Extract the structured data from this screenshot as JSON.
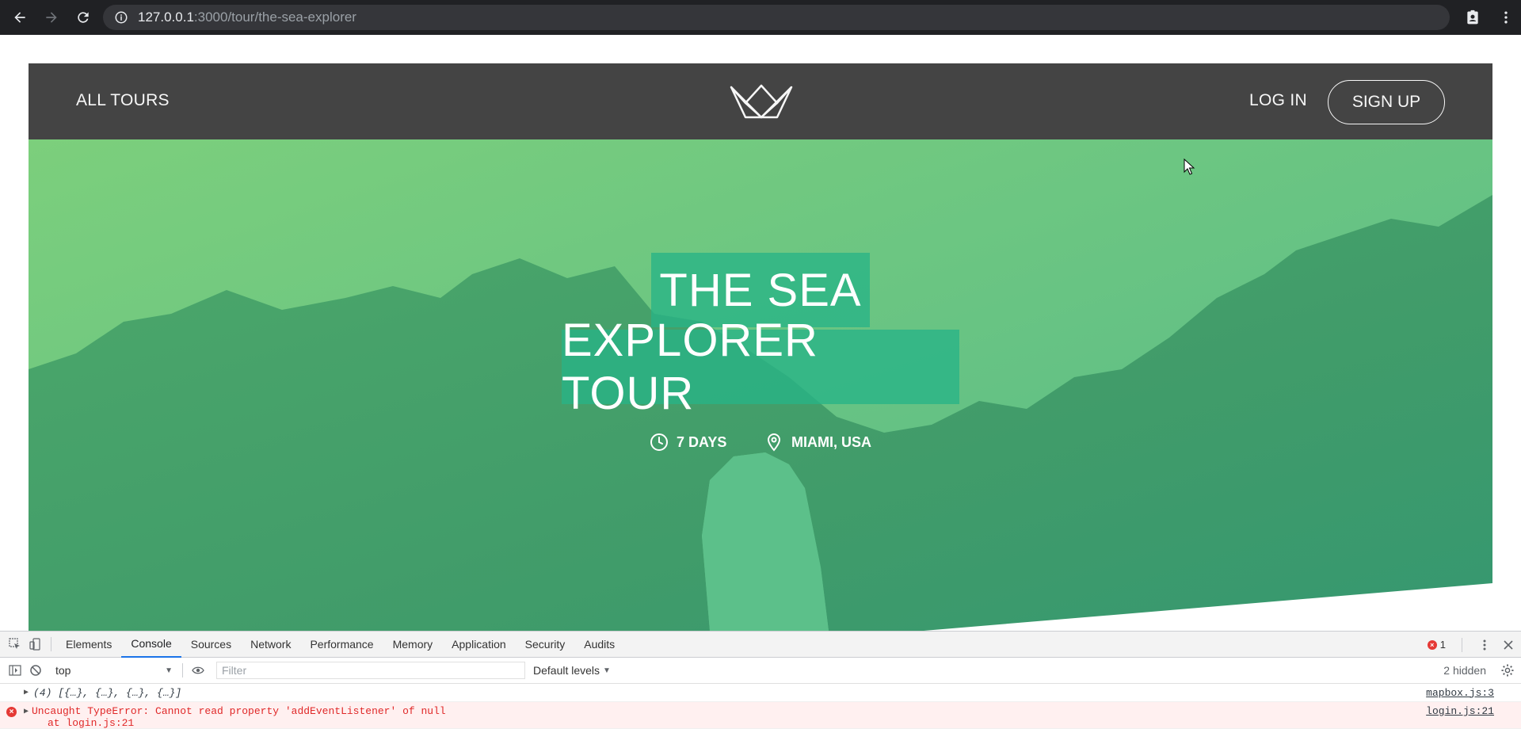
{
  "browser": {
    "url_host": "127.0.0.1",
    "url_path": ":3000/tour/the-sea-explorer"
  },
  "header": {
    "all_tours": "ALL TOURS",
    "login": "LOG IN",
    "signup": "SIGN UP"
  },
  "hero": {
    "title_line1": "THE SEA",
    "title_line2": "EXPLORER TOUR",
    "duration": "7 DAYS",
    "location": "MIAMI, USA",
    "overlay_color": "#28b487"
  },
  "devtools": {
    "tabs": [
      "Elements",
      "Console",
      "Sources",
      "Network",
      "Performance",
      "Memory",
      "Application",
      "Security",
      "Audits"
    ],
    "active_tab": "Console",
    "error_count": "1",
    "context": "top",
    "filter_placeholder": "Filter",
    "levels": "Default levels",
    "hidden": "2 hidden",
    "logs": [
      {
        "text": "(4) [{…}, {…}, {…}, {…}]",
        "source": "mapbox.js:3"
      },
      {
        "text": "Uncaught TypeError: Cannot read property 'addEventListener' of null",
        "stack": "at login.js:21",
        "source": "login.js:21"
      }
    ]
  }
}
